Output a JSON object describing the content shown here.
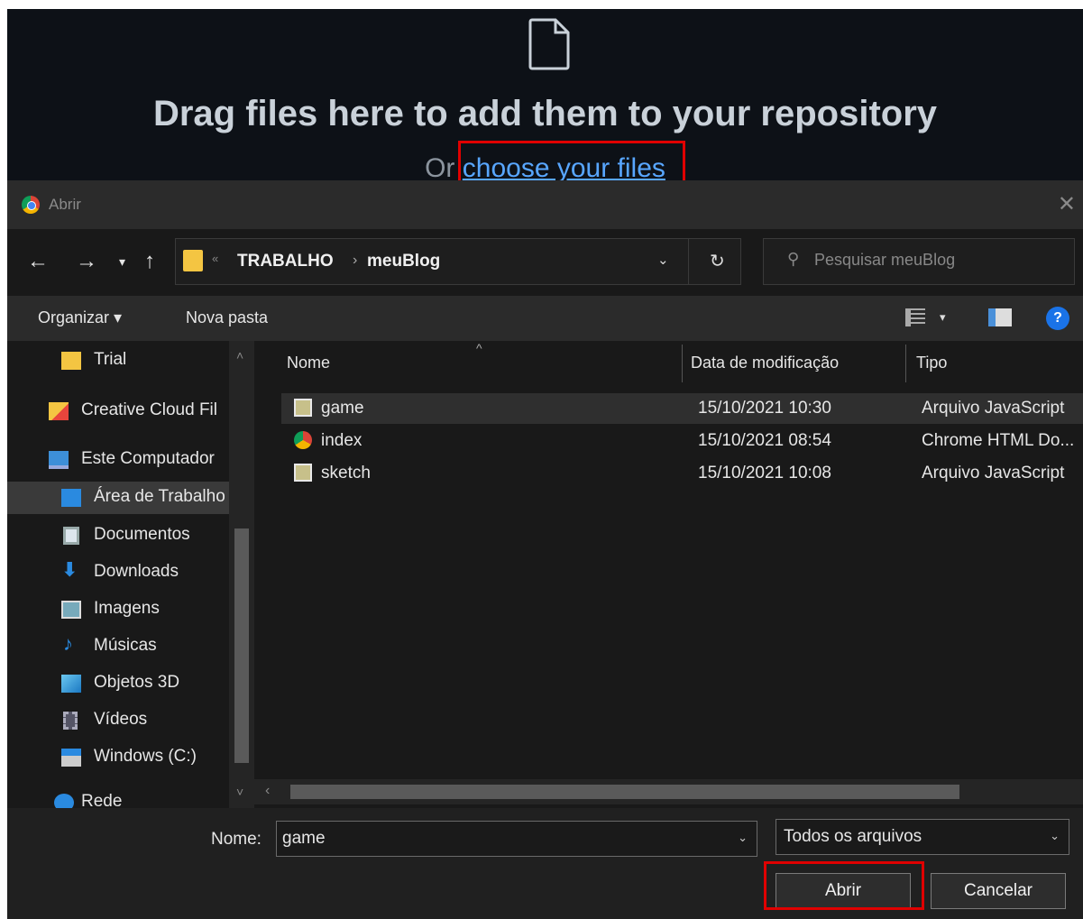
{
  "github": {
    "title": "Drag files here to add them to your repository",
    "prefix": "Or",
    "link": "choose your files"
  },
  "dialog": {
    "title": "Abrir",
    "breadcrumb": [
      "TRABALHO",
      "meuBlog"
    ],
    "breadcrumb_prefix": "«",
    "search_placeholder": "Pesquisar meuBlog",
    "commands": {
      "organize": "Organizar ▾",
      "new_folder": "Nova pasta"
    },
    "nav_items": [
      {
        "label": "Trial",
        "icon": "folder-icon"
      },
      {
        "label": "Creative Cloud Fil",
        "icon": "creative-cloud-icon"
      },
      {
        "label": "Este Computador",
        "icon": "computer-icon"
      },
      {
        "label": "Área de Trabalho",
        "icon": "desktop-icon",
        "selected": true
      },
      {
        "label": "Documentos",
        "icon": "documents-icon"
      },
      {
        "label": "Downloads",
        "icon": "downloads-icon"
      },
      {
        "label": "Imagens",
        "icon": "pictures-icon"
      },
      {
        "label": "Músicas",
        "icon": "music-icon"
      },
      {
        "label": "Objetos 3D",
        "icon": "3d-objects-icon"
      },
      {
        "label": "Vídeos",
        "icon": "videos-icon"
      },
      {
        "label": "Windows (C:)",
        "icon": "drive-icon"
      },
      {
        "label": "Rede",
        "icon": "network-icon"
      }
    ],
    "columns": {
      "name": "Nome",
      "date": "Data de modificação",
      "type": "Tipo"
    },
    "files": [
      {
        "name": "game",
        "date": "15/10/2021 10:30",
        "type": "Arquivo JavaScript",
        "icon": "js-file-icon",
        "selected": true
      },
      {
        "name": "index",
        "date": "15/10/2021 08:54",
        "type": "Chrome HTML Do...",
        "icon": "chrome-html-icon"
      },
      {
        "name": "sketch",
        "date": "15/10/2021 10:08",
        "type": "Arquivo JavaScript",
        "icon": "js-file-icon"
      }
    ],
    "filename_label": "Nome:",
    "filename_value": "game",
    "filetype": "Todos os arquivos",
    "open_label": "Abrir",
    "cancel_label": "Cancelar"
  },
  "colors": {
    "highlight": "#e00000",
    "link": "#58a6ff",
    "dialog_bg": "#202020",
    "github_bg": "#0d1117"
  }
}
